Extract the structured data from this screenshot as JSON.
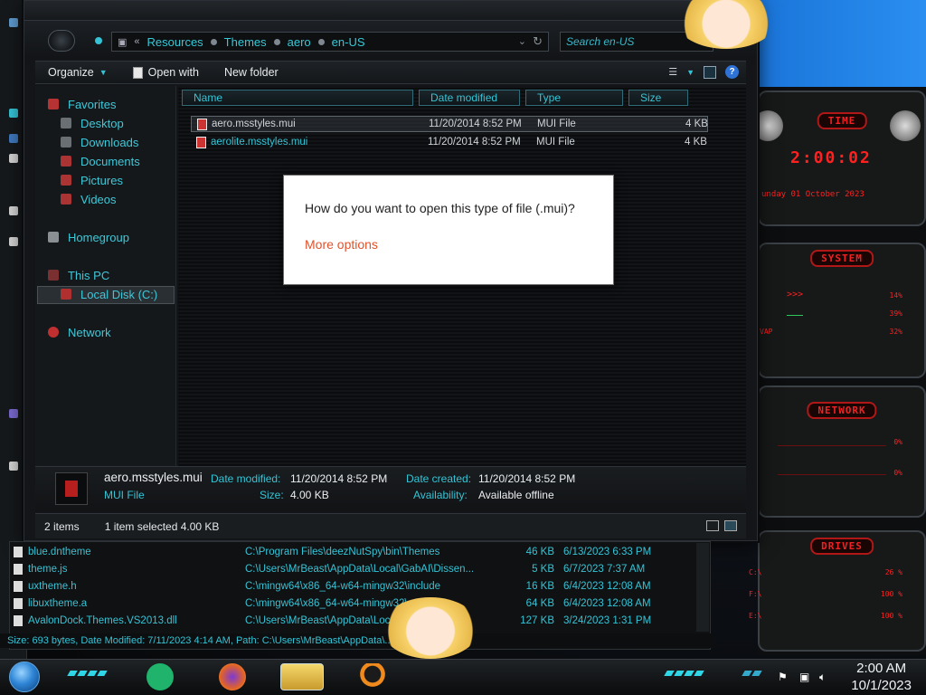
{
  "address_bar": {
    "crumbs": [
      "Resources",
      "Themes",
      "aero",
      "en-US"
    ],
    "search_placeholder": "Search en-US"
  },
  "command_bar": {
    "organize": "Organize",
    "open_with": "Open with",
    "new_folder": "New folder"
  },
  "nav": {
    "favorites": "Favorites",
    "desktop": "Desktop",
    "downloads": "Downloads",
    "documents": "Documents",
    "pictures": "Pictures",
    "videos": "Videos",
    "homegroup": "Homegroup",
    "this_pc": "This PC",
    "local_disk": "Local Disk (C:)",
    "network": "Network"
  },
  "columns": {
    "name": "Name",
    "date_modified": "Date modified",
    "type": "Type",
    "size": "Size"
  },
  "files": [
    {
      "name": "aero.msstyles.mui",
      "date": "11/20/2014 8:52 PM",
      "type": "MUI File",
      "size": "4 KB"
    },
    {
      "name": "aerolite.msstyles.mui",
      "date": "11/20/2014 8:52 PM",
      "type": "MUI File",
      "size": "4 KB"
    }
  ],
  "dialog": {
    "question": "How do you want to open this type of file (.mui)?",
    "more_options": "More options"
  },
  "details": {
    "filename": "aero.msstyles.mui",
    "filetype": "MUI File",
    "date_modified_label": "Date modified:",
    "date_modified": "11/20/2014 8:52 PM",
    "size_label": "Size:",
    "size": "4.00 KB",
    "date_created_label": "Date created:",
    "date_created": "11/20/2014 8:52 PM",
    "availability_label": "Availability:",
    "availability": "Available offline"
  },
  "status": {
    "items": "2 items",
    "selected": "1 item selected  4.00 KB"
  },
  "results": [
    {
      "name": "blue.dntheme",
      "path": "C:\\Program Files\\deezNutSpy\\bin\\Themes",
      "size": "46 KB",
      "date": "6/13/2023 6:33 PM"
    },
    {
      "name": "theme.js",
      "path": "C:\\Users\\MrBeast\\AppData\\Local\\GabAI\\Dissen...",
      "size": "5 KB",
      "date": "6/7/2023 7:37 AM"
    },
    {
      "name": "uxtheme.h",
      "path": "C:\\mingw64\\x86_64-w64-mingw32\\include",
      "size": "16 KB",
      "date": "6/4/2023 12:08 AM"
    },
    {
      "name": "libuxtheme.a",
      "path": "C:\\mingw64\\x86_64-w64-mingw32\\...",
      "size": "64 KB",
      "date": "6/4/2023 12:08 AM"
    },
    {
      "name": "AvalonDock.Themes.VS2013.dll",
      "path": "C:\\Users\\MrBeast\\AppData\\Loc...",
      "size": "127 KB",
      "date": "3/24/2023 1:31 PM"
    }
  ],
  "results_status": "Size: 693 bytes, Date Modified: 7/11/2023 4:14 AM, Path: C:\\Users\\MrBeast\\AppData\\...\\Windows\\Recent",
  "gadgets": {
    "time_title": "TIME",
    "time_value": "2:00:02",
    "date_line": "unday 01 October 2023",
    "system_title": "SYSTEM",
    "cpu_pct": "14%",
    "ram_pct": "39%",
    "swap_label": "VAP",
    "swap_pct": "32%",
    "network_title": "NETWORK",
    "net_up": "0%",
    "net_down": "0%",
    "drives_title": "DRIVES",
    "drive_c": "C:\\",
    "drive_c_pct": "26 %",
    "drive_f": "F:\\",
    "drive_f_pct": "100 %",
    "drive_e": "E:\\",
    "drive_e_pct": "100 %"
  },
  "clock": {
    "time": "2:00 AM",
    "date": "10/1/2023"
  },
  "colors": {
    "accent_cyan": "#35c4d6",
    "alert_red": "#ff2020",
    "link_orange": "#e0532c"
  }
}
